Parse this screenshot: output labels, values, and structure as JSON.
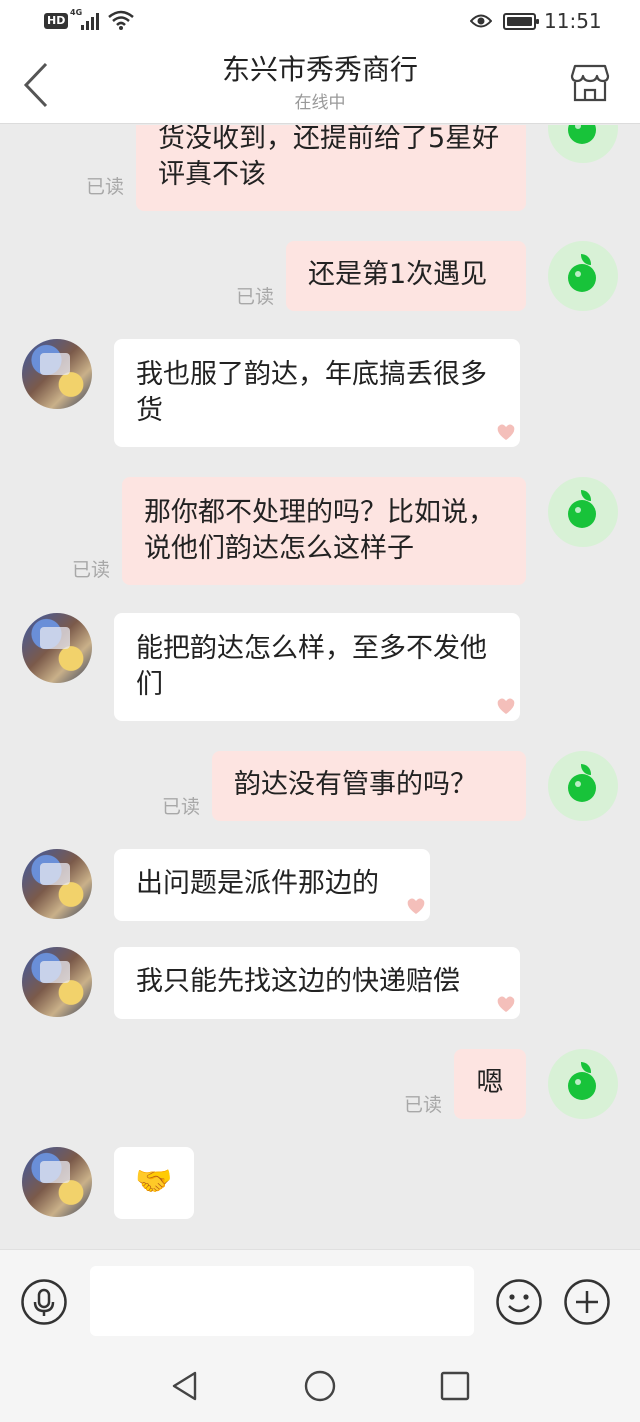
{
  "status_bar": {
    "hd_badge": "HD",
    "network": "4G",
    "time": "11:51"
  },
  "header": {
    "title": "东兴市秀秀商行",
    "subtitle": "在线中",
    "back_icon": "chevron-left-icon",
    "shop_icon": "storefront-icon"
  },
  "messages": [
    {
      "direction": "out",
      "text": "货没收到，还提前给了5星好评真不该",
      "status": "已读"
    },
    {
      "direction": "out",
      "text": "还是第1次遇见",
      "status": "已读"
    },
    {
      "direction": "in",
      "text": "我也服了韵达，年底搞丢很多货"
    },
    {
      "direction": "out",
      "text": "那你都不处理的吗？比如说，说他们韵达怎么这样子",
      "status": "已读"
    },
    {
      "direction": "in",
      "text": "能把韵达怎么样，至多不发他们"
    },
    {
      "direction": "out",
      "text": "韵达没有管事的吗？",
      "status": "已读"
    },
    {
      "direction": "in",
      "text": "出问题是派件那边的"
    },
    {
      "direction": "in",
      "text": "我只能先找这边的快递赔偿"
    },
    {
      "direction": "out",
      "text": "嗯",
      "status": "已读"
    },
    {
      "direction": "in",
      "text": "🤝"
    }
  ],
  "input_bar": {
    "voice_icon": "microphone-icon",
    "text_value": "",
    "emoji_icon": "smiley-icon",
    "plus_icon": "plus-icon"
  },
  "nav_bar": {
    "back_icon": "triangle-back-icon",
    "home_icon": "circle-home-icon",
    "recents_icon": "square-recents-icon"
  },
  "colors": {
    "outgoing_bubble": "#fde4e1",
    "incoming_bubble": "#ffffff",
    "chat_background": "#ebebeb",
    "avatar_green": "#18c33a"
  }
}
